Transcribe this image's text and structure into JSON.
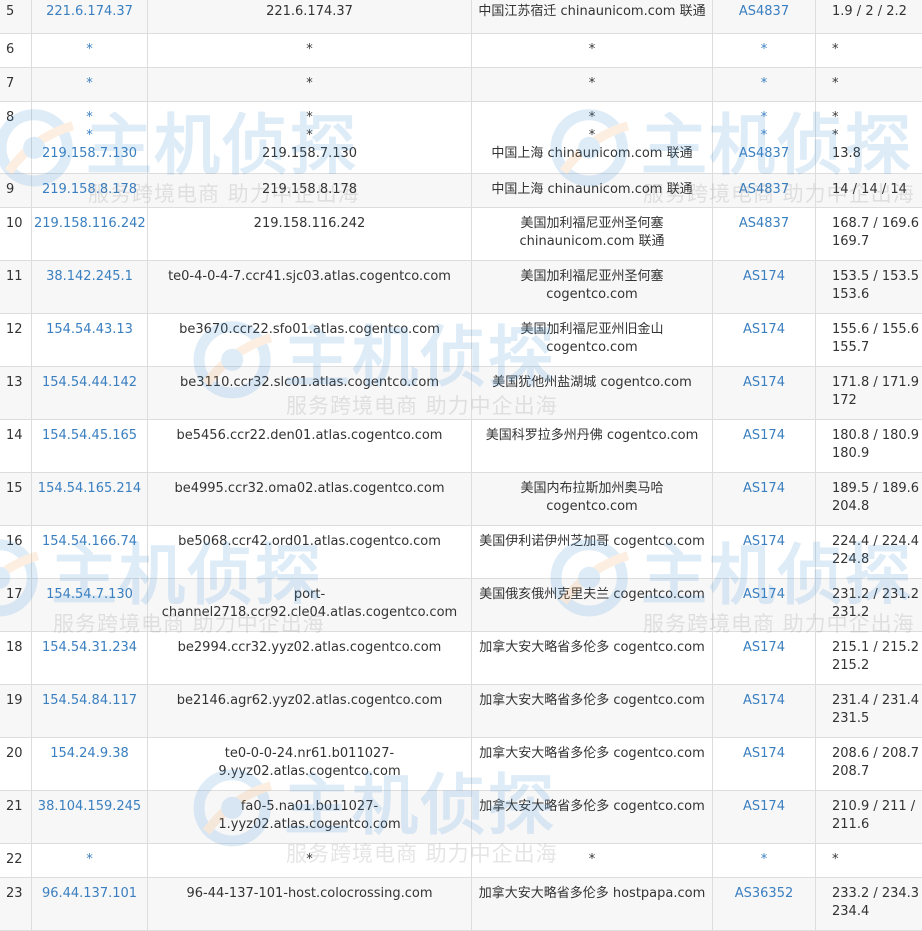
{
  "rows": [
    {
      "hop": "5",
      "ip": [
        "221.6.174.37"
      ],
      "host": [
        "221.6.174.37"
      ],
      "geo": [
        "中国江苏宿迁 chinaunicom.com 联通"
      ],
      "as": [
        "AS4837"
      ],
      "time": [
        "1.9 / 2 / 2.2"
      ]
    },
    {
      "hop": "6",
      "ip": [
        "*"
      ],
      "host": [
        "*"
      ],
      "geo": [
        "*"
      ],
      "as": [
        "*"
      ],
      "time": [
        "*"
      ]
    },
    {
      "hop": "7",
      "ip": [
        "*"
      ],
      "host": [
        "*"
      ],
      "geo": [
        "*"
      ],
      "as": [
        "*"
      ],
      "time": [
        "*"
      ]
    },
    {
      "hop": "8",
      "ip": [
        "*",
        "*",
        "219.158.7.130"
      ],
      "host": [
        "*",
        "*",
        "219.158.7.130"
      ],
      "geo": [
        "*",
        "*",
        "中国上海 chinaunicom.com 联通"
      ],
      "as": [
        "*",
        "*",
        "AS4837"
      ],
      "time": [
        "*",
        "*",
        "13.8"
      ]
    },
    {
      "hop": "9",
      "ip": [
        "219.158.8.178"
      ],
      "host": [
        "219.158.8.178"
      ],
      "geo": [
        "中国上海 chinaunicom.com 联通"
      ],
      "as": [
        "AS4837"
      ],
      "time": [
        "14 / 14 / 14"
      ]
    },
    {
      "hop": "10",
      "ip": [
        "219.158.116.242"
      ],
      "host": [
        "219.158.116.242"
      ],
      "geo": [
        "美国加利福尼亚州圣何塞",
        "chinaunicom.com 联通"
      ],
      "as": [
        "AS4837"
      ],
      "time": [
        "168.7 / 169.6 /",
        "169.7"
      ]
    },
    {
      "hop": "11",
      "ip": [
        "38.142.245.1"
      ],
      "host": [
        "te0-4-0-4-7.ccr41.sjc03.atlas.cogentco.com"
      ],
      "geo": [
        "美国加利福尼亚州圣何塞",
        "cogentco.com"
      ],
      "as": [
        "AS174"
      ],
      "time": [
        "153.5 / 153.5 /",
        "153.6"
      ]
    },
    {
      "hop": "12",
      "ip": [
        "154.54.43.13"
      ],
      "host": [
        "be3670.ccr22.sfo01.atlas.cogentco.com"
      ],
      "geo": [
        "美国加利福尼亚州旧金山",
        "cogentco.com"
      ],
      "as": [
        "AS174"
      ],
      "time": [
        "155.6 / 155.6 /",
        "155.7"
      ]
    },
    {
      "hop": "13",
      "ip": [
        "154.54.44.142"
      ],
      "host": [
        "be3110.ccr32.slc01.atlas.cogentco.com"
      ],
      "geo": [
        "美国犹他州盐湖城 cogentco.com"
      ],
      "as": [
        "AS174"
      ],
      "time": [
        "171.8 / 171.9 /",
        "172"
      ]
    },
    {
      "hop": "14",
      "ip": [
        "154.54.45.165"
      ],
      "host": [
        "be5456.ccr22.den01.atlas.cogentco.com"
      ],
      "geo": [
        "美国科罗拉多州丹佛 cogentco.com"
      ],
      "as": [
        "AS174"
      ],
      "time": [
        "180.8 / 180.9 /",
        "180.9"
      ]
    },
    {
      "hop": "15",
      "ip": [
        "154.54.165.214"
      ],
      "host": [
        "be4995.ccr32.oma02.atlas.cogentco.com"
      ],
      "geo": [
        "美国内布拉斯加州奥马哈",
        "cogentco.com"
      ],
      "as": [
        "AS174"
      ],
      "time": [
        "189.5 / 189.6 /",
        "204.8"
      ]
    },
    {
      "hop": "16",
      "ip": [
        "154.54.166.74"
      ],
      "host": [
        "be5068.ccr42.ord01.atlas.cogentco.com"
      ],
      "geo": [
        "美国伊利诺伊州芝加哥 cogentco.com"
      ],
      "as": [
        "AS174"
      ],
      "time": [
        "224.4 / 224.4 /",
        "224.8"
      ]
    },
    {
      "hop": "17",
      "ip": [
        "154.54.7.130"
      ],
      "host": [
        "port-channel2718.ccr92.cle04.atlas.cogentco.com"
      ],
      "geo": [
        "美国俄亥俄州克里夫兰 cogentco.com"
      ],
      "as": [
        "AS174"
      ],
      "time": [
        "231.2 / 231.2 /",
        "231.2"
      ]
    },
    {
      "hop": "18",
      "ip": [
        "154.54.31.234"
      ],
      "host": [
        "be2994.ccr32.yyz02.atlas.cogentco.com"
      ],
      "geo": [
        "加拿大安大略省多伦多 cogentco.com"
      ],
      "as": [
        "AS174"
      ],
      "time": [
        "215.1 / 215.2 /",
        "215.2"
      ]
    },
    {
      "hop": "19",
      "ip": [
        "154.54.84.117"
      ],
      "host": [
        "be2146.agr62.yyz02.atlas.cogentco.com"
      ],
      "geo": [
        "加拿大安大略省多伦多 cogentco.com"
      ],
      "as": [
        "AS174"
      ],
      "time": [
        "231.4 / 231.4 /",
        "231.5"
      ]
    },
    {
      "hop": "20",
      "ip": [
        "154.24.9.38"
      ],
      "host": [
        "te0-0-0-24.nr61.b011027-",
        "9.yyz02.atlas.cogentco.com"
      ],
      "geo": [
        "加拿大安大略省多伦多 cogentco.com"
      ],
      "as": [
        "AS174"
      ],
      "time": [
        "208.6 / 208.7 /",
        "208.7"
      ]
    },
    {
      "hop": "21",
      "ip": [
        "38.104.159.245"
      ],
      "host": [
        "fa0-5.na01.b011027-1.yyz02.atlas.cogentco.com"
      ],
      "geo": [
        "加拿大安大略省多伦多 cogentco.com"
      ],
      "as": [
        "AS174"
      ],
      "time": [
        "210.9 / 211 /",
        "211.6"
      ]
    },
    {
      "hop": "22",
      "ip": [
        "*"
      ],
      "host": [
        "*"
      ],
      "geo": [
        "*"
      ],
      "as": [
        "*"
      ],
      "time": [
        "*"
      ]
    },
    {
      "hop": "23",
      "ip": [
        "96.44.137.101"
      ],
      "host": [
        "96-44-137-101-host.colocrossing.com"
      ],
      "geo": [
        "加拿大安大略省多伦多 hostpapa.com"
      ],
      "as": [
        "AS36352"
      ],
      "time": [
        "233.2 / 234.3 /",
        "234.4"
      ]
    }
  ],
  "watermark": {
    "brand": "主机侦探",
    "slogan": "服务跨境电商 助力中企出海"
  },
  "colors": {
    "link": "#3a7fc0",
    "border": "#dddddd",
    "row_alt": "#f7f7f7",
    "watermark_blue": "#3b8fd9",
    "watermark_orange": "#f0a050"
  }
}
